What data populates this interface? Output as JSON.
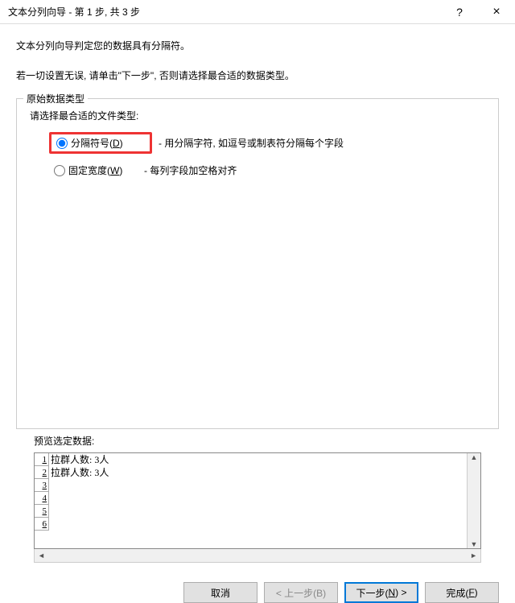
{
  "titlebar": {
    "title": "文本分列向导 - 第 1 步, 共 3 步",
    "help_icon": "?",
    "close_icon": "×"
  },
  "intro": {
    "line1": "文本分列向导判定您的数据具有分隔符。",
    "line2": "若一切设置无误, 请单击\"下一步\", 否则请选择最合适的数据类型。"
  },
  "group": {
    "legend": "原始数据类型",
    "prompt": "请选择最合适的文件类型:",
    "options": [
      {
        "label": "分隔符号(",
        "accel": "D",
        "label_end": ")",
        "desc": "- 用分隔字符, 如逗号或制表符分隔每个字段",
        "checked": true
      },
      {
        "label": "固定宽度(",
        "accel": "W",
        "label_end": ")",
        "desc": "- 每列字段加空格对齐",
        "checked": false
      }
    ]
  },
  "preview": {
    "label": "预览选定数据:",
    "rows": [
      "拉群人数: 3人",
      "拉群人数: 3人",
      "",
      "",
      "",
      ""
    ],
    "rownums": [
      "1",
      "2",
      "3",
      "4",
      "5",
      "6"
    ]
  },
  "buttons": {
    "cancel": "取消",
    "back": "< 上一步(B)",
    "next_pre": "下一步(",
    "next_accel": "N",
    "next_post": ") >",
    "finish_pre": "完成(",
    "finish_accel": "F",
    "finish_post": ")"
  }
}
